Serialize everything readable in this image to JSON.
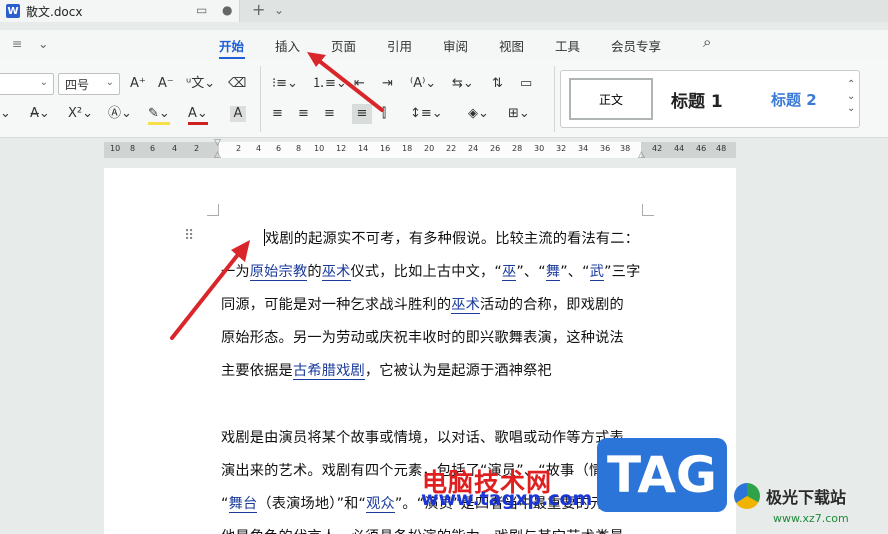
{
  "window": {
    "doc_tab": "散文.docx",
    "app_icon_letter": "W",
    "new_tab": "+"
  },
  "menu": {
    "items": [
      "开始",
      "插入",
      "页面",
      "引用",
      "审阅",
      "视图",
      "工具",
      "会员专享"
    ],
    "active": "开始"
  },
  "ribbon": {
    "font_size": "四号",
    "styles": {
      "normal": "正文",
      "h1": "标题 1",
      "h2": "标题 2"
    }
  },
  "ruler": {
    "labels": [
      "10",
      "8",
      "6",
      "4",
      "2",
      "2",
      "4",
      "6",
      "8",
      "10",
      "12",
      "14",
      "16",
      "18",
      "20",
      "22",
      "24",
      "26",
      "28",
      "30",
      "32",
      "34",
      "36",
      "38",
      "42",
      "44",
      "46",
      "48"
    ]
  },
  "doc": {
    "p1l1": "戏剧的起源实不可考，有多种假说。比较主流的看法有二：",
    "p1l2a": "一为",
    "p1l2b": "原始宗教",
    "p1l2c": "的",
    "p1l2d": "巫术",
    "p1l2e": "仪式，比如上古中文，“",
    "p1l2f": "巫",
    "p1l2g": "”、“",
    "p1l2h": "舞",
    "p1l2i": "”、“",
    "p1l2j": "武",
    "p1l2k": "”三字",
    "p1l3a": "同源，可能是对一种乞求战斗胜利的",
    "p1l3b": "巫术",
    "p1l3c": "活动的合称，即戏剧的",
    "p1l4": "原始形态。另一为劳动或庆祝丰收时的即兴歌舞表演，这种说法",
    "p1l5a": "主要依据是",
    "p1l5b": "古希腊戏剧",
    "p1l5c": "，它被认为是起源于酒神祭祀",
    "p2l1": "戏剧是由演员将某个故事或情境，以对话、歌唱或动作等方式表",
    "p2l2": "演出来的艺术。戏剧有四个元素，包括了“演员”、“故事（情境）”、",
    "p2l3a": "“",
    "p2l3b": "舞台",
    "p2l3c": "（表演场地）”和“",
    "p2l3d": "观众",
    "p2l3e": "”。“演员”是四者当中最重要的元素，",
    "p2l4": "他是角色的代言人，必须具备扮演的能力。戏剧与其它艺术类最"
  },
  "watermark": {
    "cn": "电脑技术网",
    "url": "www.tagxp.com",
    "tag": "TAG",
    "jg_name": "极光下载站",
    "jg_url": "www.xz7.com"
  },
  "colors": {
    "accent": "#1e5fd6",
    "arrow": "#d9262b"
  }
}
